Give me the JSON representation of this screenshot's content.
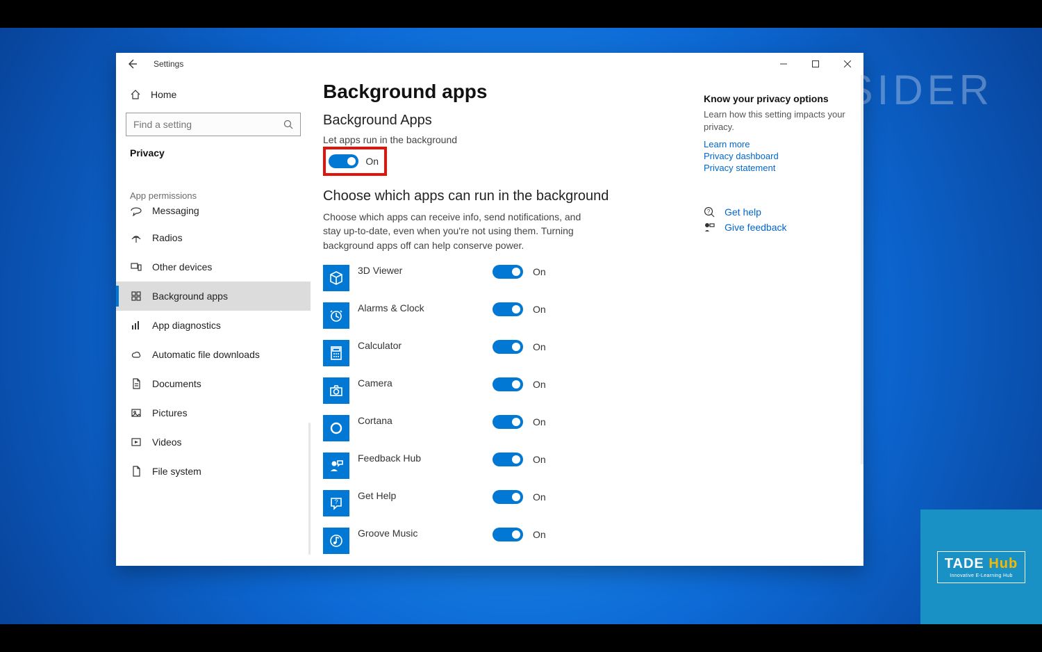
{
  "window": {
    "title": "Settings",
    "home_label": "Home",
    "search_placeholder": "Find a setting",
    "category": "Privacy",
    "group_label": "App permissions"
  },
  "nav": {
    "items": [
      {
        "label": "Messaging",
        "icon": "message"
      },
      {
        "label": "Radios",
        "icon": "radio"
      },
      {
        "label": "Other devices",
        "icon": "devices"
      },
      {
        "label": "Background apps",
        "icon": "grid",
        "selected": true
      },
      {
        "label": "App diagnostics",
        "icon": "diag"
      },
      {
        "label": "Automatic file downloads",
        "icon": "cloud"
      },
      {
        "label": "Documents",
        "icon": "doc"
      },
      {
        "label": "Pictures",
        "icon": "picture"
      },
      {
        "label": "Videos",
        "icon": "video"
      },
      {
        "label": "File system",
        "icon": "file"
      }
    ]
  },
  "page": {
    "title": "Background apps",
    "section1_title": "Background Apps",
    "master_label": "Let apps run in the background",
    "master_toggle": {
      "state": "On"
    },
    "section2_title": "Choose which apps can run in the background",
    "section2_desc": "Choose which apps can receive info, send notifications, and stay up-to-date, even when you're not using them. Turning background apps off can help conserve power.",
    "apps": [
      {
        "name": "3D Viewer",
        "state": "On",
        "icon": "cube"
      },
      {
        "name": "Alarms & Clock",
        "state": "On",
        "icon": "clock"
      },
      {
        "name": "Calculator",
        "state": "On",
        "icon": "calc"
      },
      {
        "name": "Camera",
        "state": "On",
        "icon": "camera"
      },
      {
        "name": "Cortana",
        "state": "On",
        "icon": "circle"
      },
      {
        "name": "Feedback Hub",
        "state": "On",
        "icon": "feedback"
      },
      {
        "name": "Get Help",
        "state": "On",
        "icon": "help"
      },
      {
        "name": "Groove Music",
        "state": "On",
        "icon": "music"
      }
    ]
  },
  "sidepanel": {
    "title": "Know your privacy options",
    "desc": "Learn how this setting impacts your privacy.",
    "links": [
      {
        "label": "Learn more"
      },
      {
        "label": "Privacy dashboard"
      },
      {
        "label": "Privacy statement"
      }
    ],
    "help": {
      "label": "Get help"
    },
    "feedback": {
      "label": "Give feedback"
    }
  },
  "overlays": {
    "insider": "INSIDER",
    "tadehub_line1a": "TADE ",
    "tadehub_line1b": "Hub",
    "tadehub_line2": "Innovative E-Learning Hub"
  }
}
